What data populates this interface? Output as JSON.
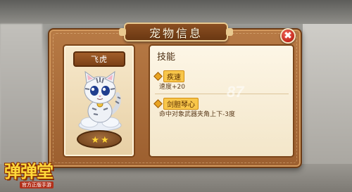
{
  "dialog": {
    "title": "宠物信息",
    "close_glyph": "✖"
  },
  "pet": {
    "name": "飞虎",
    "stars": [
      "★",
      "★"
    ],
    "star_count": 2
  },
  "skills": {
    "heading": "技能",
    "items": [
      {
        "name": "疾速",
        "effect": "速度+20"
      },
      {
        "name": "剑胆琴心",
        "effect": "命中对象武器夹角上下-3度"
      }
    ]
  },
  "logo": {
    "title": "弹弹堂",
    "subtitle": "官方正版手游"
  },
  "watermark": "87"
}
